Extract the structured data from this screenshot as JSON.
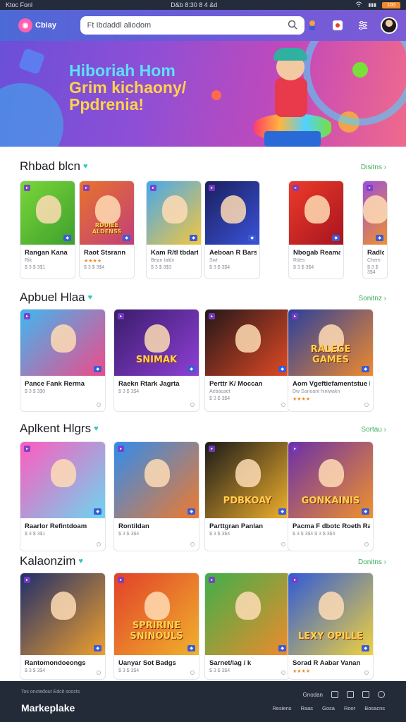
{
  "status_bar": {
    "left": "Ktoc Fonl",
    "center": "D&b 8:30 8 4 &d",
    "battery": "100"
  },
  "topbar": {
    "logo_text": "Cbiay",
    "search": {
      "placeholder": "Ft Ibdaddl aliodom"
    }
  },
  "banner": {
    "line1": "Hiboriah Hom",
    "line2": "Grim kichaony/",
    "line3": "Ppdrenia!"
  },
  "sections": [
    {
      "title": "Rhbad blcn",
      "see_all": "Disitns",
      "cards": [
        {
          "name": "Rangan Kana",
          "sub": "Rik",
          "stars": "",
          "price": "$ 3 $ 3$1",
          "thumb_label": "",
          "colors": [
            "#7ad63a",
            "#3ea02c"
          ]
        },
        {
          "name": "Raot Stsrann",
          "sub": "",
          "stars": "★★★★",
          "price": "$ 3 $ 3$4",
          "thumb_label": "RDUIEE ALDENSS",
          "colors": [
            "#e8732c",
            "#c23f7a"
          ]
        },
        {
          "name": "Kam R/tl tbdart",
          "sub": "Bean Ialdx",
          "stars": "",
          "price": "$ 3 $ 3$3",
          "thumb_label": "",
          "colors": [
            "#45a8ef",
            "#f5c63e"
          ]
        },
        {
          "name": "Aeboan R Barslt",
          "sub": "Swt",
          "stars": "",
          "price": "$ 3 $ 3$4",
          "thumb_label": "",
          "colors": [
            "#1a1f5c",
            "#3b52d9"
          ]
        },
        {
          "name": "Nbogab Reama",
          "sub": "Rdes",
          "stars": "",
          "price": "$ 3 $ 3$4",
          "thumb_label": "",
          "colors": [
            "#ee3b2a",
            "#a6141e"
          ]
        },
        {
          "name": "Radlc",
          "sub": "Chem",
          "stars": "",
          "price": "$ 3 $ 3$4",
          "thumb_label": "",
          "colors": [
            "#9c50d8",
            "#f0922c"
          ]
        }
      ]
    },
    {
      "title": "Apbuel Hlaa",
      "see_all": "Sonitnz",
      "cards": [
        {
          "name": "Pance Fank Rerma",
          "sub": "",
          "stars": "",
          "price": "$ 3 $ 3$0",
          "thumb_label": "",
          "colors": [
            "#3fb7f0",
            "#f04a8a"
          ]
        },
        {
          "name": "Raekn Rtark Jagrta",
          "sub": "",
          "stars": "",
          "price": "$ 3 $ 3$4",
          "thumb_label": "SNIMAK",
          "colors": [
            "#3a1d6b",
            "#8e3fd6"
          ]
        },
        {
          "name": "Perttr K/ Moccan",
          "sub": "Aebacaet",
          "stars": "",
          "price": "$ 3 $ 3$4",
          "thumb_label": "",
          "colors": [
            "#24171a",
            "#e24a24"
          ]
        },
        {
          "name": "Aom Vgeftiefamentstue I",
          "sub": "Dw Sanoant hiniwakn",
          "stars": "★★★★",
          "price": "",
          "thumb_label": "RALEGE GAMES",
          "colors": [
            "#2a3f9d",
            "#f08a2c"
          ]
        }
      ]
    },
    {
      "title": "Aplkent Hlgrs",
      "see_all": "Sortau",
      "cards": [
        {
          "name": "Raarlor Refintdoam",
          "sub": "",
          "stars": "",
          "price": "$ 3 $ 3$1",
          "thumb_label": "",
          "colors": [
            "#ff5bbd",
            "#6bd6f0"
          ]
        },
        {
          "name": "Rontildan",
          "sub": "",
          "stars": "",
          "price": "$ 3 $ 3$4",
          "thumb_label": "",
          "colors": [
            "#2f8cf0",
            "#f07a2c"
          ]
        },
        {
          "name": "Parttgran Panlan",
          "sub": "",
          "stars": "",
          "price": "$ 3 $ 3$4",
          "thumb_label": "PDBKOAY",
          "colors": [
            "#1a1a1a",
            "#f2b12c"
          ]
        },
        {
          "name": "Pacma F dbotc Roeth Rado",
          "sub": "",
          "stars": "",
          "price": "$ 3 $ 3$4 $ 3 $ 3$4",
          "thumb_label": "GONKAINIS",
          "colors": [
            "#6b2fa8",
            "#f0922c"
          ]
        }
      ]
    },
    {
      "title": "Kalaonzim",
      "see_all": "Donitns",
      "cards": [
        {
          "name": "Rantomondoeongs",
          "sub": "",
          "stars": "",
          "price": "$ 3 $ 3$4",
          "thumb_label": "",
          "colors": [
            "#1f2e6b",
            "#f0a02c"
          ]
        },
        {
          "name": "Uanyar Sot Badgs",
          "sub": "",
          "stars": "",
          "price": "$ 3 $ 3$4",
          "thumb_label": "SPRIRINE SNINOULS",
          "colors": [
            "#e2402a",
            "#f0b22c"
          ]
        },
        {
          "name": "Sarnet/lag / k",
          "sub": "",
          "stars": "",
          "price": "$ 3 $ 3$4",
          "thumb_label": "",
          "colors": [
            "#3fb04a",
            "#f08a2c"
          ]
        },
        {
          "name": "Sorad R Aabar Vanan",
          "sub": "",
          "stars": "★★★★",
          "price": "",
          "thumb_label": "LEXY OPILLE",
          "colors": [
            "#2f5ad8",
            "#f0d23c"
          ]
        }
      ]
    }
  ],
  "footer": {
    "tiny_text": "Tos onctedout Edcit soocts",
    "brand": "Markeplake",
    "links": [
      "Resiens",
      "Raas",
      "Gosa",
      "Roor",
      "Bosacns"
    ],
    "icon_label": "Gnodan"
  }
}
